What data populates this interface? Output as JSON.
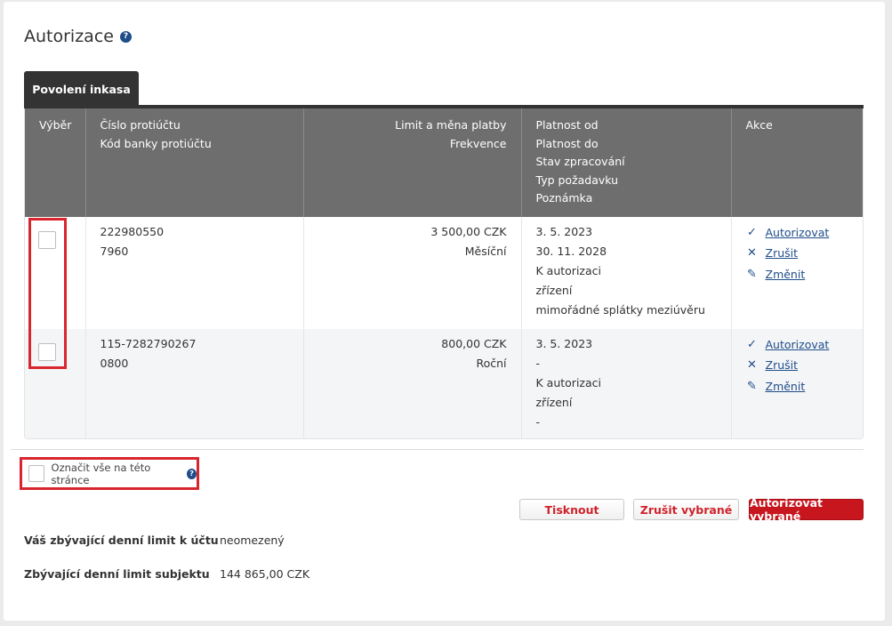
{
  "page": {
    "title": "Autorizace",
    "help_glyph": "?"
  },
  "tabs": [
    {
      "label": "Povolení inkasa",
      "active": true
    }
  ],
  "table": {
    "headers": {
      "select": [
        "Výběr"
      ],
      "account": [
        "Číslo protiúčtu",
        "Kód banky protiúčtu"
      ],
      "limit": [
        "Limit a měna platby",
        "Frekvence"
      ],
      "validity": [
        "Platnost od",
        "Platnost do",
        "Stav zpracování",
        "Typ požadavku",
        "Poznámka"
      ],
      "actions": [
        "Akce"
      ]
    },
    "rows": [
      {
        "account": [
          "222980550",
          "7960"
        ],
        "limit": [
          "3 500,00 CZK",
          "Měsíční"
        ],
        "validity": [
          "3. 5. 2023",
          "30. 11. 2028",
          "K autorizaci",
          "zřízení",
          "mimořádné splátky meziúvěru"
        ],
        "checked": false
      },
      {
        "account": [
          "115-7282790267",
          "0800"
        ],
        "limit": [
          "800,00 CZK",
          "Roční"
        ],
        "validity": [
          "3. 5. 2023",
          "-",
          "K autorizaci",
          "zřízení",
          "-"
        ],
        "checked": false
      }
    ],
    "actions": [
      {
        "label": "Autorizovat",
        "icon": "check-icon",
        "glyph": "✓"
      },
      {
        "label": "Zrušit",
        "icon": "close-icon",
        "glyph": "✕"
      },
      {
        "label": "Změnit",
        "icon": "pencil-icon",
        "glyph": "✎"
      }
    ]
  },
  "select_all": {
    "label": "Označit vše na této stránce",
    "checked": false
  },
  "buttons": {
    "print": "Tisknout",
    "cancel_selected": "Zrušit vybrané",
    "authorize_selected": "Autorizovat vybrané"
  },
  "limits": [
    {
      "label": "Váš zbývající denní limit k účtu",
      "value": "neomezený"
    },
    {
      "label": "Zbývající denní limit subjektu",
      "value": "144 865,00 CZK"
    }
  ],
  "colors": {
    "accent_red": "#c8161e",
    "link_blue": "#1f4d8a",
    "header_gray": "#6e6e6e",
    "tab_dark": "#333333"
  }
}
